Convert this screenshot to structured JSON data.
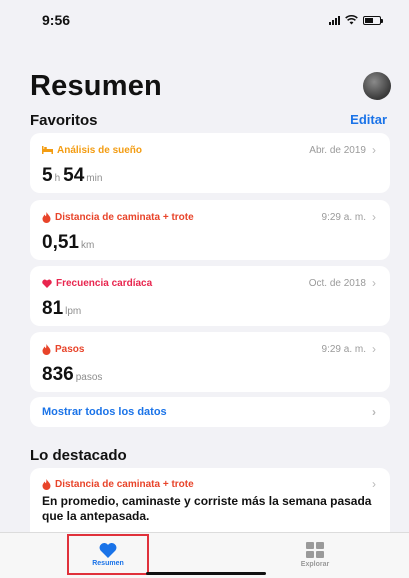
{
  "status_bar": {
    "time": "9:56"
  },
  "page": {
    "title": "Resumen"
  },
  "favorites": {
    "title": "Favoritos",
    "edit_label": "Editar",
    "cards": [
      {
        "icon": "bed-icon",
        "name": "Análisis de sueño",
        "meta": "Abr. de 2019",
        "value1": "5",
        "unit1": "h",
        "value2": "54",
        "unit2": "min",
        "color": "#f39c12"
      },
      {
        "icon": "flame-icon",
        "name": "Distancia de caminata + trote",
        "meta": "9:29 a. m.",
        "value1": "0,51",
        "unit1": "km",
        "color": "#e8442a"
      },
      {
        "icon": "heart-icon",
        "name": "Frecuencia cardíaca",
        "meta": "Oct. de 2018",
        "value1": "81",
        "unit1": "lpm",
        "color": "#e8254e"
      },
      {
        "icon": "flame-icon",
        "name": "Pasos",
        "meta": "9:29 a. m.",
        "value1": "836",
        "unit1": "pasos",
        "color": "#e8442a"
      }
    ],
    "show_all_label": "Mostrar todos los datos"
  },
  "highlights": {
    "title": "Lo destacado",
    "card": {
      "icon": "flame-icon",
      "name": "Distancia de caminata + trote",
      "text": "En promedio, caminaste y corriste más la semana pasada que la antepasada."
    }
  },
  "tabbar": {
    "tabs": [
      {
        "label": "Resumen",
        "icon": "heart-icon",
        "selected": true
      },
      {
        "label": "Explorar",
        "icon": "grid-icon",
        "selected": false
      }
    ]
  }
}
